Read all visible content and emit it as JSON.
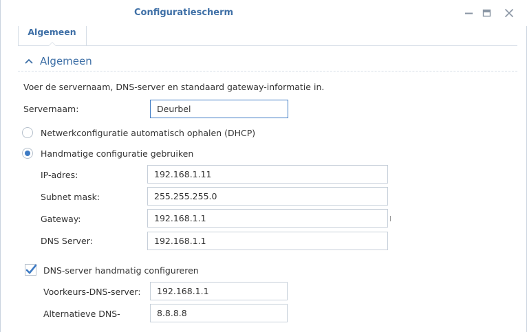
{
  "window": {
    "title": "Configuratiescherm"
  },
  "tabs": [
    {
      "label": "Algemeen",
      "active": true
    }
  ],
  "section": {
    "title": "Algemeen",
    "description": "Voer de servernaam, DNS-server en standaard gateway-informatie in."
  },
  "server": {
    "label": "Servernaam:",
    "value": "Deurbel"
  },
  "network": {
    "dhcp_label": "Netwerkconfiguratie automatisch ophalen (DHCP)",
    "dhcp_selected": false,
    "manual_label": "Handmatige configuratie gebruiken",
    "manual_selected": true,
    "ip_label": "IP-adres:",
    "ip_value": "192.168.1.11",
    "subnet_label": "Subnet mask:",
    "subnet_value": "255.255.255.0",
    "gateway_label": "Gateway:",
    "gateway_value": "192.168.1.1",
    "dns_label": "DNS Server:",
    "dns_value": "192.168.1.1"
  },
  "dns_manual": {
    "checkbox_label": "DNS-server handmatig configureren",
    "checked": true,
    "preferred_label": "Voorkeurs-DNS-server:",
    "preferred_value": "192.168.1.1",
    "alternate_label": "Alternatieve DNS-",
    "alternate_value": "8.8.8.8"
  },
  "colors": {
    "accent": "#3e6fa6",
    "selection": "#3e7bc4",
    "border": "#c6cfd9"
  },
  "icons": {
    "minimize": "minimize-icon",
    "maximize": "maximize-icon",
    "close": "close-icon",
    "collapse": "chevron-up-icon",
    "check": "checkmark-icon"
  }
}
